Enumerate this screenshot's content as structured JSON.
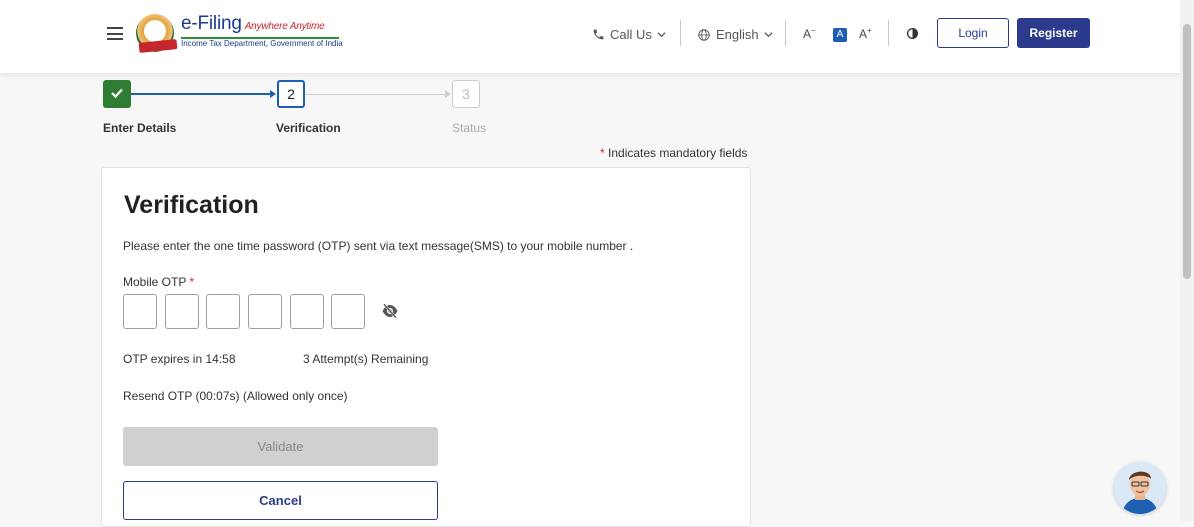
{
  "header": {
    "logo_title": "e-Filing",
    "logo_tagline": "Anywhere Anytime",
    "logo_subtitle": "Income Tax Department, Government of India",
    "call_us": "Call Us",
    "language": "English",
    "font_decrease": "A",
    "font_normal": "A",
    "font_increase": "A",
    "login": "Login",
    "register": "Register"
  },
  "stepper": {
    "steps": [
      {
        "number": "",
        "label": "Enter Details",
        "state": "completed"
      },
      {
        "number": "2",
        "label": "Verification",
        "state": "active"
      },
      {
        "number": "3",
        "label": "Status",
        "state": "pending"
      }
    ]
  },
  "mandatory_note": {
    "star": "*",
    "text": "Indicates mandatory fields"
  },
  "verification": {
    "title": "Verification",
    "description": "Please enter the one time password (OTP) sent via text message(SMS) to your mobile number .",
    "otp_label": "Mobile OTP",
    "otp_required": "*",
    "otp_digits": [
      "",
      "",
      "",
      "",
      "",
      ""
    ],
    "otp_expiry": "OTP expires in 14:58",
    "attempts": "3 Attempt(s) Remaining",
    "resend": "Resend OTP (00:07s)  (Allowed only once)",
    "validate_label": "Validate",
    "cancel_label": "Cancel"
  },
  "colors": {
    "primary": "#2b3a8c",
    "accent_blue": "#1e5fb4",
    "success": "#2e7d32",
    "required": "#d32f2f"
  }
}
